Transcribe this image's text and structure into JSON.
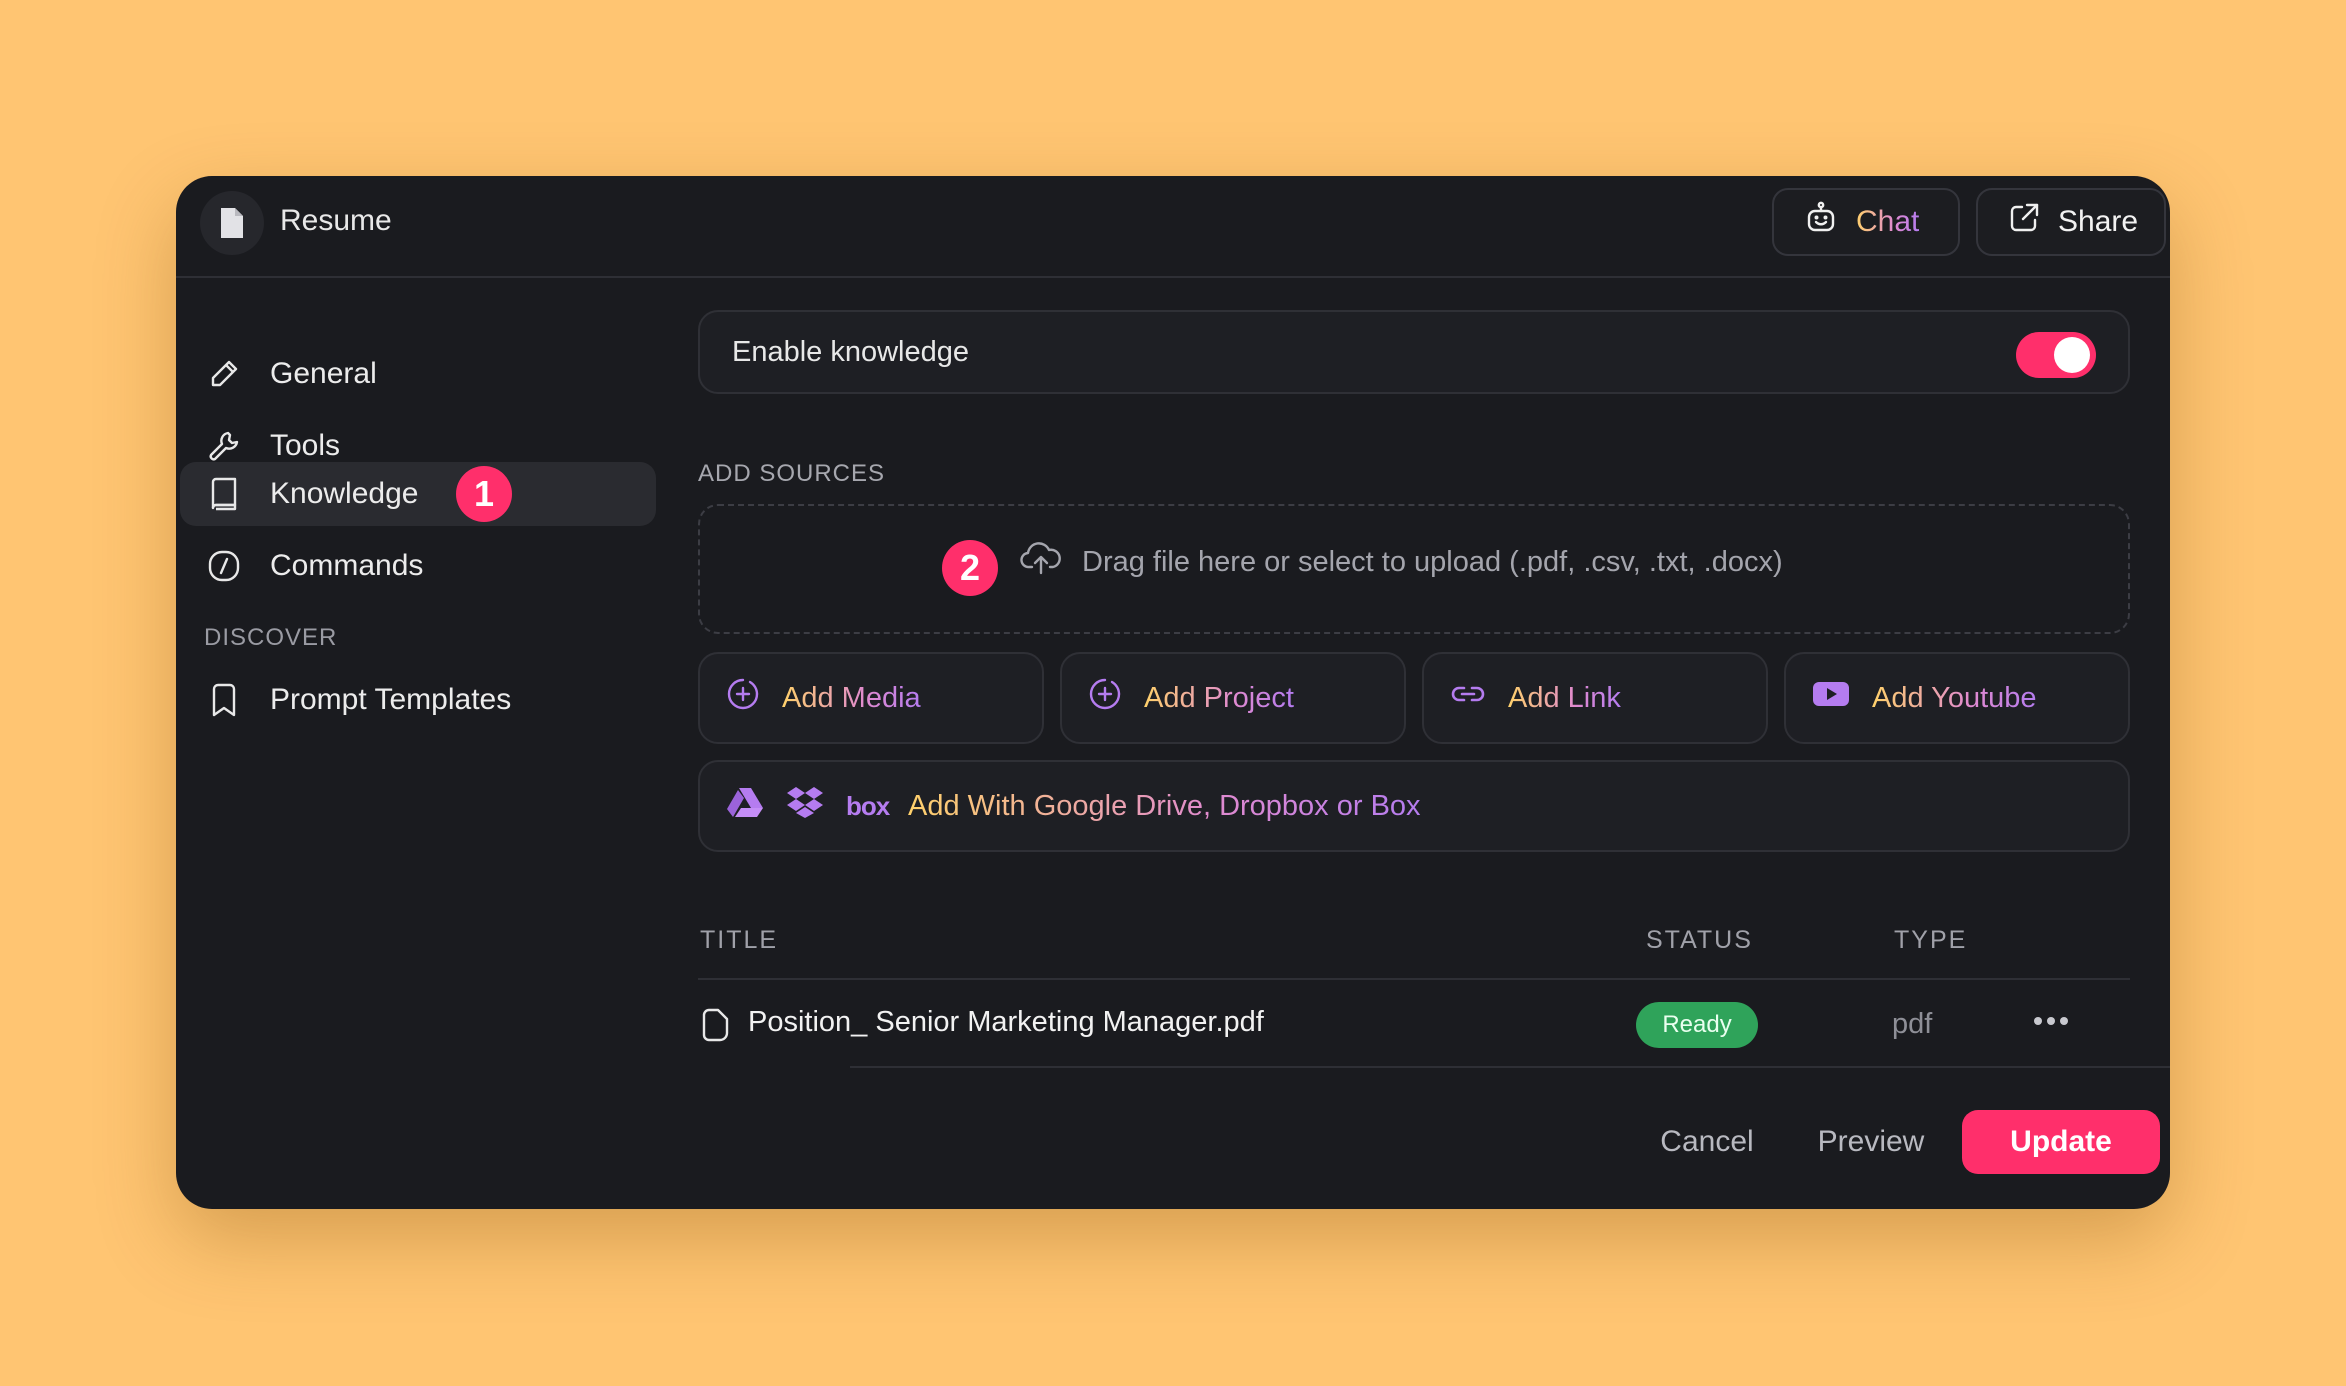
{
  "header": {
    "doc_title": "Resume",
    "chat_label": "Chat",
    "share_label": "Share"
  },
  "sidebar": {
    "items": [
      {
        "label": "General",
        "icon": "pencil-icon"
      },
      {
        "label": "Tools",
        "icon": "wrench-icon"
      },
      {
        "label": "Knowledge",
        "icon": "book-icon",
        "active": true
      },
      {
        "label": "Commands",
        "icon": "slash-command-icon"
      }
    ],
    "discover_heading": "DISCOVER",
    "discover_items": [
      {
        "label": "Prompt Templates",
        "icon": "bookmark-icon"
      }
    ]
  },
  "annotations": {
    "step1": "1",
    "step2": "2"
  },
  "knowledge": {
    "enable_label": "Enable knowledge",
    "enabled": true,
    "add_sources_heading": "ADD SOURCES",
    "dropzone_text": "Drag file here or select to upload (.pdf, .csv, .txt, .docx)",
    "add_buttons": [
      {
        "label": "Add Media",
        "icon": "media-plus-icon"
      },
      {
        "label": "Add Project",
        "icon": "project-plus-icon"
      },
      {
        "label": "Add Link",
        "icon": "link-icon"
      },
      {
        "label": "Add Youtube",
        "icon": "youtube-icon"
      }
    ],
    "cloud_label": "Add With Google Drive, Dropbox or Box",
    "cloud_icons": [
      "google-drive-icon",
      "dropbox-icon",
      "box-icon"
    ],
    "box_logo_text": "box"
  },
  "table": {
    "headers": {
      "title": "TITLE",
      "status": "STATUS",
      "type": "TYPE"
    },
    "rows": [
      {
        "title": "Position_ Senior Marketing Manager.pdf",
        "status": "Ready",
        "type": "pdf"
      }
    ]
  },
  "footer": {
    "cancel_label": "Cancel",
    "preview_label": "Preview",
    "update_label": "Update"
  },
  "colors": {
    "background": "#FFC572",
    "window": "#1a1b1f",
    "accent": "#ff2f6b",
    "status_ready": "#2fa35a",
    "icon_purple": "#b57cf0"
  }
}
